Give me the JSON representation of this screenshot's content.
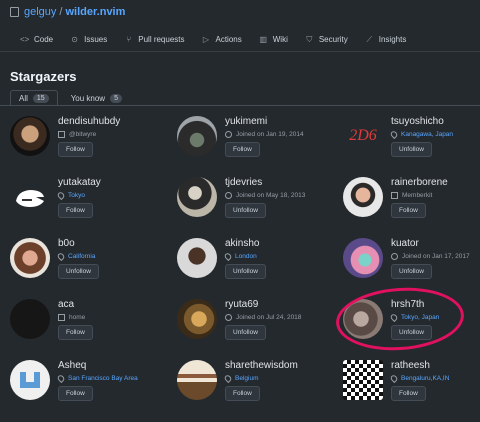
{
  "repo": {
    "owner": "gelguy",
    "separator": "/",
    "name": "wilder.nvim"
  },
  "nav_tabs": [
    {
      "label": "Code",
      "icon": "code-icon"
    },
    {
      "label": "Issues",
      "icon": "issue-icon"
    },
    {
      "label": "Pull requests",
      "icon": "pull-request-icon"
    },
    {
      "label": "Actions",
      "icon": "play-icon"
    },
    {
      "label": "Wiki",
      "icon": "book-icon"
    },
    {
      "label": "Security",
      "icon": "shield-icon"
    },
    {
      "label": "Insights",
      "icon": "graph-icon"
    }
  ],
  "page_title": "Stargazers",
  "subtabs": [
    {
      "label": "All",
      "count": "15"
    },
    {
      "label": "You know",
      "count": "5"
    }
  ],
  "users": [
    {
      "name": "dendisuhubdy",
      "meta": "@bitwyre",
      "meta_type": "org",
      "button": "Follow"
    },
    {
      "name": "yukimemi",
      "meta": "Joined on Jan 19, 2014",
      "meta_type": "joined",
      "button": "Follow"
    },
    {
      "name": "tsuyoshicho",
      "meta": "Kanagawa, Japan",
      "meta_type": "location",
      "button": "Unfollow"
    },
    {
      "name": "yutakatay",
      "meta": "Tokyo",
      "meta_type": "location",
      "button": "Follow"
    },
    {
      "name": "tjdevries",
      "meta": "Joined on May 18, 2013",
      "meta_type": "joined",
      "button": "Unfollow"
    },
    {
      "name": "rainerborene",
      "meta": "Memberkit",
      "meta_type": "org",
      "button": "Follow"
    },
    {
      "name": "b0o",
      "meta": "California",
      "meta_type": "location",
      "button": "Unfollow"
    },
    {
      "name": "akinsho",
      "meta": "London",
      "meta_type": "location",
      "button": "Unfollow"
    },
    {
      "name": "kuator",
      "meta": "Joined on Jan 17, 2017",
      "meta_type": "joined",
      "button": "Unfollow"
    },
    {
      "name": "aca",
      "meta": "home",
      "meta_type": "org",
      "button": "Follow"
    },
    {
      "name": "ryuta69",
      "meta": "Joined on Jul 24, 2018",
      "meta_type": "joined",
      "button": "Unfollow"
    },
    {
      "name": "hrsh7th",
      "meta": "Tokyo, Japan",
      "meta_type": "location",
      "button": "Unfollow"
    },
    {
      "name": "Asheq",
      "meta": "San Francisco Bay Area",
      "meta_type": "location",
      "button": "Follow"
    },
    {
      "name": "sharethewisdom",
      "meta": "Belgium",
      "meta_type": "location",
      "button": "Follow"
    },
    {
      "name": "ratheesh",
      "meta": "Bengaluru,KA,IN",
      "meta_type": "location",
      "button": "Follow"
    }
  ],
  "tsuyoshicho_avatar_text": "2D6",
  "colors": {
    "background": "#24292e",
    "link": "#58a6ff",
    "highlight": "#e0115f"
  }
}
